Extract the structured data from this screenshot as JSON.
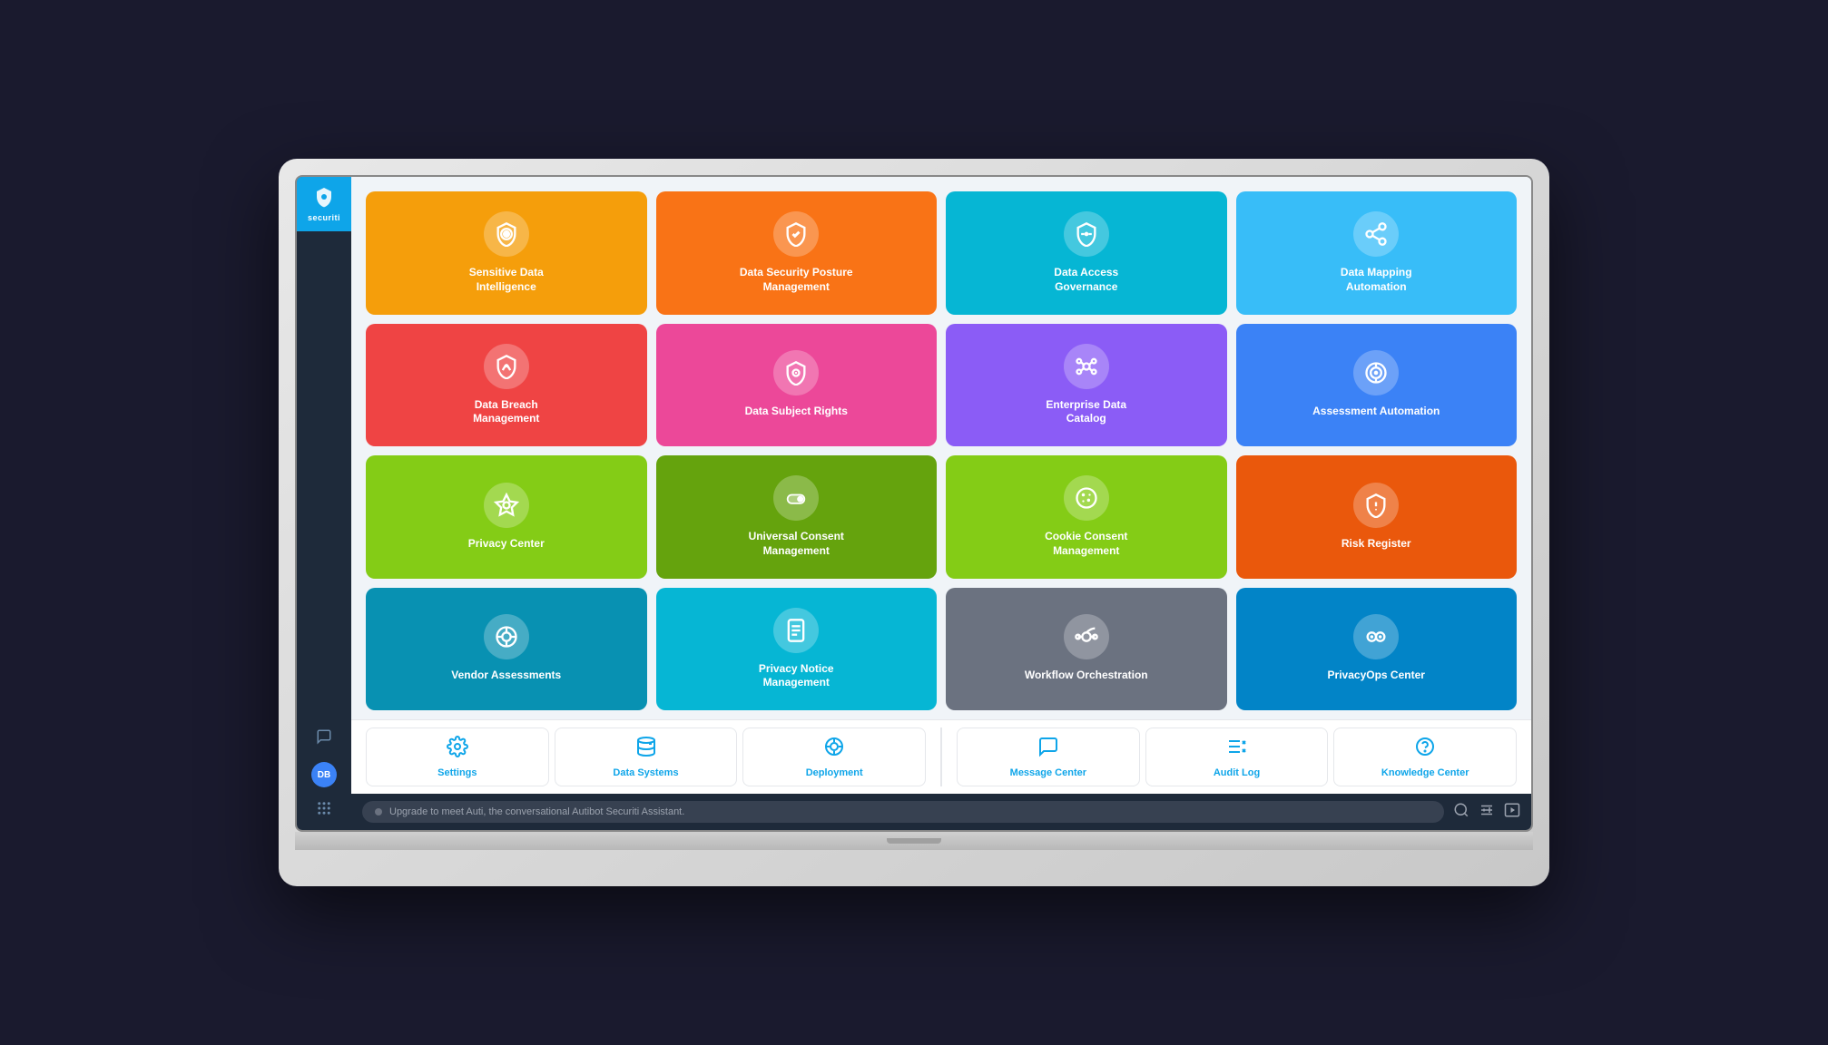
{
  "app": {
    "name": "securiti",
    "logo_text": "securiti"
  },
  "sidebar": {
    "avatar_initials": "DB",
    "chat_icon": "💬",
    "grid_icon": "⠿"
  },
  "tiles": [
    {
      "id": "sensitive-data-intelligence",
      "label": "Sensitive Data Intelligence",
      "color_class": "tile-orange",
      "icon_type": "shield-gear"
    },
    {
      "id": "data-security-posture",
      "label": "Data Security Posture Management",
      "color_class": "tile-orange2",
      "icon_type": "shield-check"
    },
    {
      "id": "data-access-governance",
      "label": "Data Access Governance",
      "color_class": "tile-teal",
      "icon_type": "shield-lock"
    },
    {
      "id": "data-mapping-automation",
      "label": "Data Mapping Automation",
      "color_class": "tile-blue-light",
      "icon_type": "share-nodes"
    },
    {
      "id": "data-breach-management",
      "label": "Data Breach Management",
      "color_class": "tile-red",
      "icon_type": "shield-wifi"
    },
    {
      "id": "data-subject-rights",
      "label": "Data Subject Rights",
      "color_class": "tile-pink",
      "icon_type": "shield-circle"
    },
    {
      "id": "enterprise-data-catalog",
      "label": "Enterprise Data Catalog",
      "color_class": "tile-purple",
      "icon_type": "nodes"
    },
    {
      "id": "assessment-automation",
      "label": "Assessment Automation",
      "color_class": "tile-blue",
      "icon_type": "eye-circle"
    },
    {
      "id": "privacy-center",
      "label": "Privacy Center",
      "color_class": "tile-lime",
      "icon_type": "hexagon-gear"
    },
    {
      "id": "universal-consent-management",
      "label": "Universal Consent Management",
      "color_class": "tile-lime2",
      "icon_type": "toggle"
    },
    {
      "id": "cookie-consent-management",
      "label": "Cookie Consent Management",
      "color_class": "tile-lime3",
      "icon_type": "cookie"
    },
    {
      "id": "risk-register",
      "label": "Risk Register",
      "color_class": "tile-red-orange",
      "icon_type": "shield-exclaim"
    },
    {
      "id": "vendor-assessments",
      "label": "Vendor Assessments",
      "color_class": "tile-cyan",
      "icon_type": "settings-circle"
    },
    {
      "id": "privacy-notice-management",
      "label": "Privacy Notice Management",
      "color_class": "tile-cyan2",
      "icon_type": "document"
    },
    {
      "id": "workflow-orchestration",
      "label": "Workflow Orchestration",
      "color_class": "tile-gray",
      "icon_type": "workflow"
    },
    {
      "id": "privacyops-center",
      "label": "PrivacyOps Center",
      "color_class": "tile-sky",
      "icon_type": "eyes"
    }
  ],
  "tools": [
    {
      "id": "settings",
      "label": "Settings",
      "icon": "⚙"
    },
    {
      "id": "data-systems",
      "label": "Data Systems",
      "icon": "🗄"
    },
    {
      "id": "deployment",
      "label": "Deployment",
      "icon": "⚙"
    },
    {
      "id": "message-center",
      "label": "Message Center",
      "icon": "💬"
    },
    {
      "id": "audit-log",
      "label": "Audit Log",
      "icon": "≡×"
    },
    {
      "id": "knowledge-center",
      "label": "Knowledge Center",
      "icon": "?"
    }
  ],
  "bottom_bar": {
    "chat_placeholder": "Upgrade to meet Auti, the conversational Autibot Securiti Assistant."
  }
}
